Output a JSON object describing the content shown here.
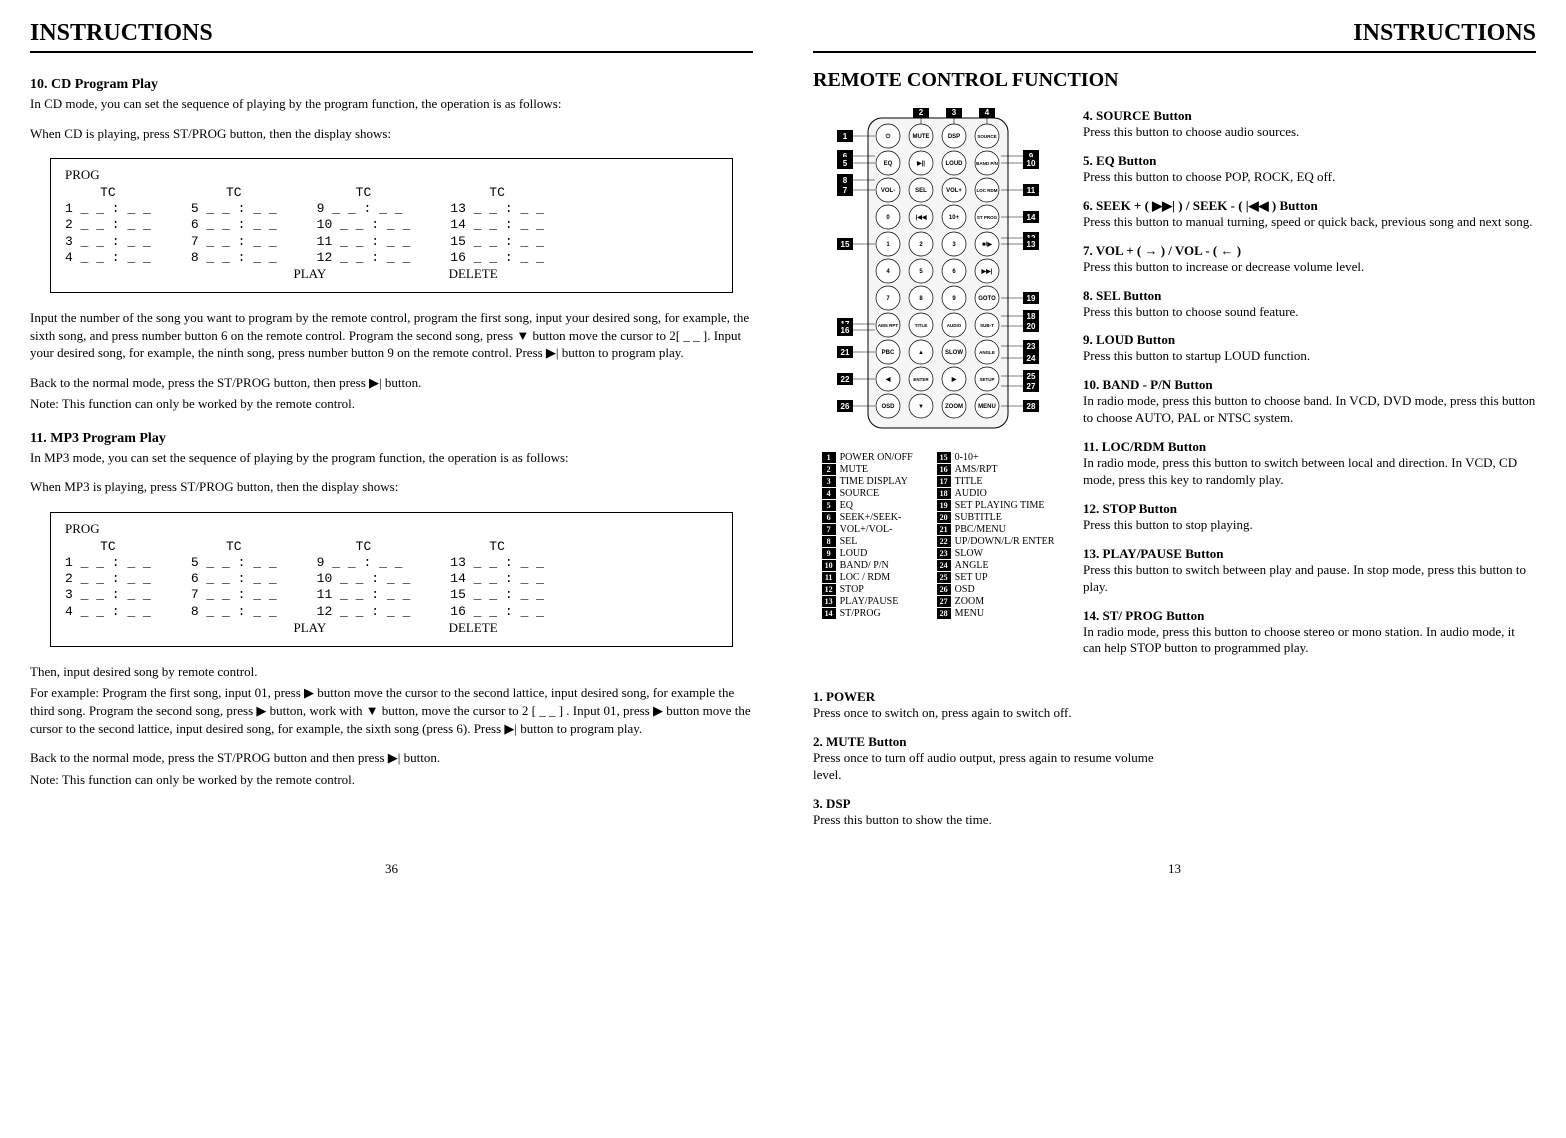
{
  "left": {
    "header": "INSTRUCTIONS",
    "s10_title": "10. CD Program Play",
    "s10_p1": "In CD mode, you can set the sequence of playing by the program function, the operation is as follows:",
    "s10_p2": "When CD is playing, press ST/PROG button, then the display shows:",
    "prog_label": "PROG",
    "tc_label": "TC",
    "play_label": "PLAY",
    "delete_label": "DELETE",
    "prog_rows": {
      "c1": [
        "1  _ _ : _ _",
        "2  _ _ : _ _",
        "3  _ _ : _ _",
        "4  _ _ : _ _"
      ],
      "c2": [
        "5  _ _ : _ _",
        "6  _ _ : _ _",
        "7  _ _ : _ _",
        "8  _ _ : _ _"
      ],
      "c3": [
        "9   _ _ : _ _",
        "10 _ _ : _ _",
        "11 _ _ : _ _",
        "12 _ _ : _ _"
      ],
      "c4": [
        "13  _ _ : _ _",
        "14 _ _ : _ _",
        "15 _ _ : _ _",
        "16 _ _ : _ _"
      ]
    },
    "s10_p3": "Input the number of the song you want to program by the remote control, program the first song, input your desired song, for example, the sixth song, and press number button 6 on the remote control. Program the second song, press ▼ button move the cursor to 2[ _ _ ]. Input your desired song, for example, the ninth song, press number button 9 on the remote control. Press ▶| button to program play.",
    "s10_p4": "Back to the normal mode, press the ST/PROG button, then press ▶| button.",
    "s10_p5": "Note: This function can only be worked by the remote control.",
    "s11_title": "11. MP3 Program Play",
    "s11_p1": "In MP3 mode, you can set the sequence of playing by the program function, the operation is as follows:",
    "s11_p2": "When MP3 is playing, press ST/PROG button, then the display shows:",
    "s11_p3": "Then, input desired song by remote control.",
    "s11_p4": "For example: Program the first song, input 01, press ▶ button move the cursor to the second lattice, input desired song, for example the third song. Program the second song, press ▶ button, work with ▼ button, move the cursor to 2 [ _ _ ] . Input 01, press ▶ button move the cursor to the second lattice, input desired song, for example, the sixth song (press 6). Press  ▶| button to program play.",
    "s11_p5": "Back to the normal mode, press the ST/PROG button and then press ▶| button.",
    "s11_p6": "Note: This function can only be worked by the remote control.",
    "page_num": "36"
  },
  "right": {
    "header": "INSTRUCTIONS",
    "title": "REMOTE CONTROL FUNCTION",
    "remote_buttons": {
      "r1": [
        "⏻",
        "MUTE",
        "DSP",
        "SOURCE"
      ],
      "r2": [
        "EQ",
        "▶||",
        "LOUD",
        "BAND P/N"
      ],
      "r3": [
        "VOL-",
        "SEL",
        "VOL+",
        "LOC RDM"
      ],
      "r4": [
        "0",
        "|◀◀",
        "10+",
        "ST PROG"
      ],
      "r5": [
        "1",
        "2",
        "3",
        "■/▶"
      ],
      "r6": [
        "4",
        "5",
        "6",
        "▶▶|"
      ],
      "r7": [
        "7",
        "8",
        "9",
        "GOTO"
      ],
      "r8": [
        "AMS RPT",
        "TITLE",
        "AUDIO",
        "SUB-T"
      ],
      "r9": [
        "PBC",
        "▲",
        "SLOW",
        "ANGLE"
      ],
      "r10": [
        "◀",
        "ENTER",
        "▶",
        "SETUP"
      ],
      "r11": [
        "OSD",
        "▼",
        "ZOOM",
        "MENU"
      ]
    },
    "callouts_left": [
      "1",
      "6",
      "5",
      "8",
      "7",
      "15",
      "17",
      "16",
      "21",
      "22",
      "26"
    ],
    "callouts_top": [
      "2",
      "3",
      "4"
    ],
    "callouts_right": [
      "9",
      "10",
      "11",
      "14",
      "12",
      "13",
      "19",
      "18",
      "20",
      "23",
      "24",
      "25",
      "27",
      "28"
    ],
    "legend": {
      "col1": [
        {
          "n": "1",
          "t": "POWER ON/OFF"
        },
        {
          "n": "2",
          "t": "MUTE"
        },
        {
          "n": "3",
          "t": "TIME DISPLAY"
        },
        {
          "n": "4",
          "t": "SOURCE"
        },
        {
          "n": "5",
          "t": "EQ"
        },
        {
          "n": "6",
          "t": "SEEK+/SEEK-"
        },
        {
          "n": "7",
          "t": "VOL+/VOL-"
        },
        {
          "n": "8",
          "t": "SEL"
        },
        {
          "n": "9",
          "t": "LOUD"
        },
        {
          "n": "10",
          "t": "BAND/ P/N"
        },
        {
          "n": "11",
          "t": "LOC / RDM"
        },
        {
          "n": "12",
          "t": "STOP"
        },
        {
          "n": "13",
          "t": "PLAY/PAUSE"
        },
        {
          "n": "14",
          "t": "ST/PROG"
        }
      ],
      "col2": [
        {
          "n": "15",
          "t": "0-10+"
        },
        {
          "n": "16",
          "t": "AMS/RPT"
        },
        {
          "n": "17",
          "t": "TITLE"
        },
        {
          "n": "18",
          "t": "AUDIO"
        },
        {
          "n": "19",
          "t": "SET PLAYING TIME"
        },
        {
          "n": "20",
          "t": "SUBTITLE"
        },
        {
          "n": "21",
          "t": "PBC/MENU"
        },
        {
          "n": "22",
          "t": " UP/DOWN/L/R ENTER"
        },
        {
          "n": "23",
          "t": "SLOW"
        },
        {
          "n": "24",
          "t": "ANGLE"
        },
        {
          "n": "25",
          "t": "SET UP"
        },
        {
          "n": "26",
          "t": "OSD"
        },
        {
          "n": "27",
          "t": "ZOOM"
        },
        {
          "n": "28",
          "t": " MENU"
        }
      ]
    },
    "desc_left": [
      {
        "t": "1. POWER",
        "d": "Press once to switch on, press again to switch off."
      },
      {
        "t": "2. MUTE Button",
        "d": "Press once to turn off audio output, press again to resume volume level."
      },
      {
        "t": "3. DSP",
        "d": "Press this button to show the time."
      }
    ],
    "desc_right": [
      {
        "t": "4. SOURCE Button",
        "d": "Press this button to choose audio sources."
      },
      {
        "t": "5. EQ Button",
        "d": "Press this button to choose POP, ROCK, EQ off."
      },
      {
        "t": "6. SEEK + ( ▶▶| ) / SEEK - ( |◀◀ ) Button",
        "d": "Press this button to manual turning, speed or quick back, previous song and next song."
      },
      {
        "t": "7. VOL + (  → ) / VOL - (  ←  )",
        "d": "Press this button to increase or decrease volume level."
      },
      {
        "t": "8. SEL Button",
        "d": "Press this button to choose sound feature."
      },
      {
        "t": "9. LOUD Button",
        "d": "Press this button to startup LOUD function."
      },
      {
        "t": "10. BAND - P/N Button",
        "d": "In radio mode, press this button to choose band. In VCD, DVD mode, press this button to choose AUTO, PAL or NTSC system."
      },
      {
        "t": "11. LOC/RDM Button",
        "d": "In radio mode, press this button to switch between local and direction. In VCD, CD mode, press this key to randomly play."
      },
      {
        "t": "12. STOP Button",
        "d": "Press this button to stop playing."
      },
      {
        "t": "13. PLAY/PAUSE Button",
        "d": "Press this button to switch between play and pause. In stop mode, press this button to play."
      },
      {
        "t": "14. ST/ PROG Button",
        "d": "In radio mode, press this button to choose stereo or mono station. In audio mode, it can help STOP button to programmed play."
      }
    ],
    "page_num": "13"
  }
}
